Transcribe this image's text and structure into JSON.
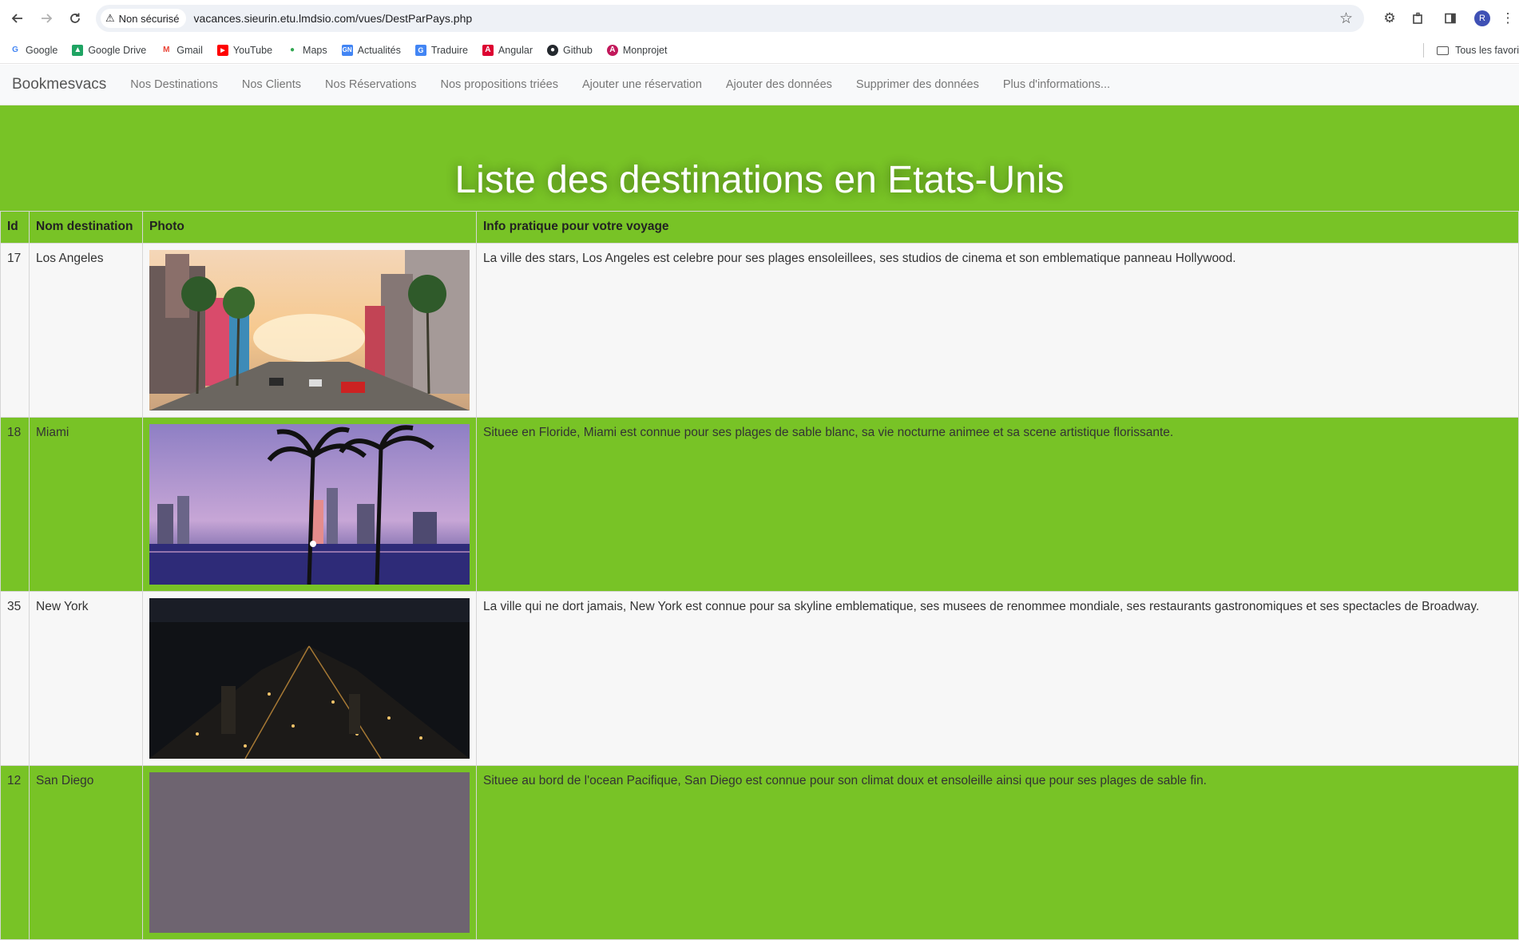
{
  "browser": {
    "security_label": "Non sécurisé",
    "url": "vacances.sieurin.etu.lmdsio.com/vues/DestParPays.php",
    "profile_initial": "R"
  },
  "bookmarks": {
    "items": [
      {
        "label": "Google",
        "icon": "google-icon",
        "color": "#4285f4"
      },
      {
        "label": "Google Drive",
        "icon": "drive-icon",
        "color": "#1fa463"
      },
      {
        "label": "Gmail",
        "icon": "gmail-icon",
        "color": "#ea4335"
      },
      {
        "label": "YouTube",
        "icon": "youtube-icon",
        "color": "#ff0000"
      },
      {
        "label": "Maps",
        "icon": "maps-icon",
        "color": "#34a853"
      },
      {
        "label": "Actualités",
        "icon": "news-icon",
        "color": "#4285f4"
      },
      {
        "label": "Traduire",
        "icon": "translate-icon",
        "color": "#4285f4"
      },
      {
        "label": "Angular",
        "icon": "angular-icon",
        "color": "#dd0031"
      },
      {
        "label": "Github",
        "icon": "github-icon",
        "color": "#24292e"
      },
      {
        "label": "Monprojet",
        "icon": "monprojet-icon",
        "color": "#c2185b"
      }
    ],
    "all_bookmarks_label": "Tous les favori"
  },
  "site_nav": {
    "brand": "Bookmesvacs",
    "links": [
      "Nos Destinations",
      "Nos Clients",
      "Nos Réservations",
      "Nos propositions triées",
      "Ajouter une réservation",
      "Ajouter des données",
      "Supprimer des données",
      "Plus d'informations..."
    ]
  },
  "hero": {
    "title": "Liste des destinations en Etats-Unis",
    "color": "#78c326"
  },
  "table": {
    "headers": [
      "Id",
      "Nom destination",
      "Photo",
      "Info pratique pour votre voyage"
    ],
    "rows": [
      {
        "id": "17",
        "name": "Los Angeles",
        "photo": "los-angeles-photo",
        "info": "La ville des stars, Los Angeles est celebre pour ses plages ensoleillees, ses studios de cinema et son emblematique panneau Hollywood."
      },
      {
        "id": "18",
        "name": "Miami",
        "photo": "miami-photo",
        "info": "Situee en Floride, Miami est connue pour ses plages de sable blanc, sa vie nocturne animee et sa scene artistique florissante."
      },
      {
        "id": "35",
        "name": "New York",
        "photo": "new-york-photo",
        "info": "La ville qui ne dort jamais, New York est connue pour sa skyline emblematique, ses musees de renommee mondiale, ses restaurants gastronomiques et ses spectacles de Broadway."
      },
      {
        "id": "12",
        "name": "San Diego",
        "photo": "san-diego-photo",
        "info": "Situee au bord de l'ocean Pacifique, San Diego est connue pour son climat doux et ensoleille ainsi que pour ses plages de sable fin."
      }
    ]
  }
}
